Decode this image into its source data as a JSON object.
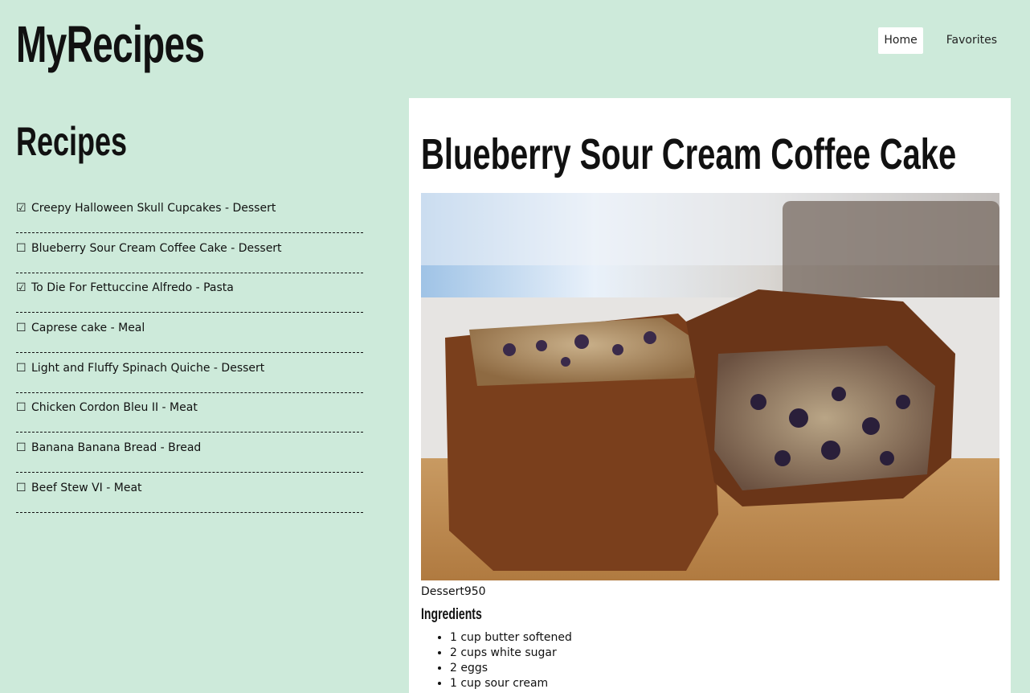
{
  "header": {
    "site_title": "MyRecipes",
    "nav": [
      {
        "label": "Home",
        "active": true
      },
      {
        "label": "Favorites",
        "active": false
      }
    ]
  },
  "sidebar": {
    "title": "Recipes",
    "items": [
      {
        "check": "☑",
        "label": "Creepy Halloween Skull Cupcakes - Dessert"
      },
      {
        "check": "☐",
        "label": "Blueberry Sour Cream Coffee Cake - Dessert"
      },
      {
        "check": "☑",
        "label": "To Die For Fettuccine Alfredo - Pasta"
      },
      {
        "check": "☐",
        "label": "Caprese cake - Meal"
      },
      {
        "check": "☐",
        "label": "Light and Fluffy Spinach Quiche - Dessert"
      },
      {
        "check": "☐",
        "label": "Chicken Cordon Bleu II - Meat"
      },
      {
        "check": "☐",
        "label": "Banana Banana Bread - Bread"
      },
      {
        "check": "☐",
        "label": "Beef Stew VI - Meat"
      }
    ]
  },
  "main": {
    "title": "Blueberry Sour Cream Coffee Cake",
    "photo_icon": "blueberry-coffee-cake-photo",
    "caption": "Dessert950",
    "ingredients_heading": "Ingredients",
    "ingredients": [
      "1 cup butter softened",
      "2 cups white sugar",
      "2 eggs",
      "1 cup sour cream"
    ]
  },
  "colors": {
    "background": "#cdeada",
    "panel": "#ffffff",
    "active_nav": "#ffffff"
  }
}
